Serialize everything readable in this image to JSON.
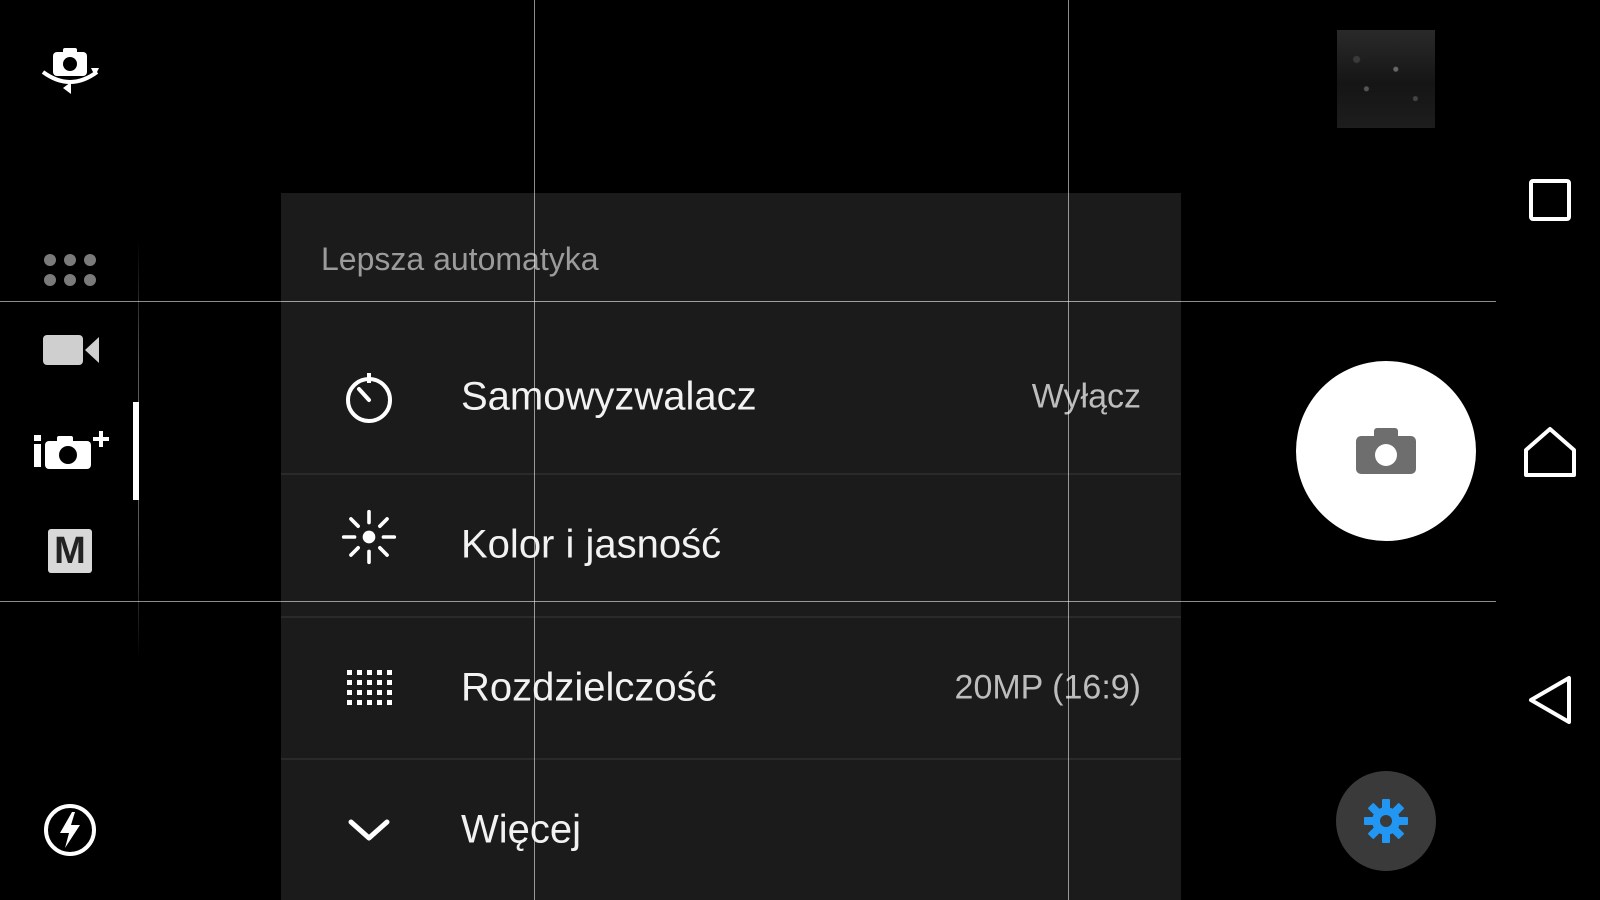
{
  "panel": {
    "title": "Lepsza automatyka",
    "rows": [
      {
        "label": "Samowyzwalacz",
        "value": "Wyłącz",
        "icon": "self-timer-icon"
      },
      {
        "label": "Kolor i jasność",
        "value": "",
        "icon": "brightness-icon"
      },
      {
        "label": "Rozdzielczość",
        "value": "20MP (16:9)",
        "icon": "resolution-grid-icon"
      },
      {
        "label": "Więcej",
        "value": "",
        "icon": "chevron-down-icon"
      }
    ]
  },
  "left_bar": {
    "icons": [
      "switch-camera-icon",
      "apps-grid-icon",
      "video-camera-icon",
      "superior-auto-icon",
      "manual-mode-icon",
      "flash-auto-icon"
    ],
    "manual_mode_letter": "M"
  },
  "right_bar": {
    "icons": [
      "gallery-thumbnail",
      "shutter-camera-icon",
      "settings-gear-icon"
    ],
    "settings_color": "#2196F3"
  },
  "nav_bar": {
    "icons": [
      "recents-icon",
      "home-icon",
      "back-icon"
    ]
  },
  "colors": {
    "background": "#000000",
    "panel": "#1b1b1b",
    "accent": "#2196F3"
  }
}
